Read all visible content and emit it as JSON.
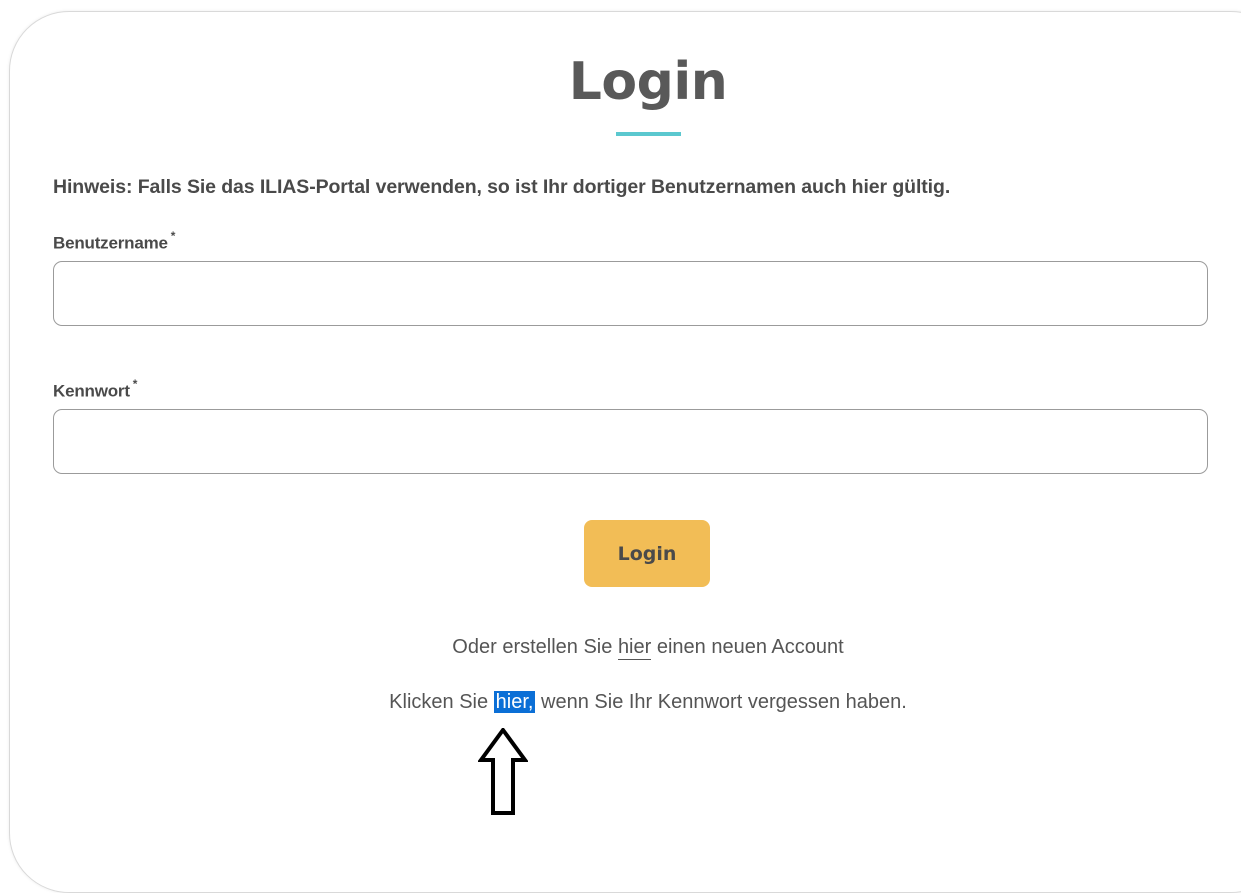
{
  "page": {
    "title": "Login",
    "hint": "Hinweis: Falls Sie das ILIAS-Portal verwenden, so ist Ihr dortiger Benutzernamen auch hier gültig."
  },
  "form": {
    "username_label": "Benutzername",
    "password_label": "Kennwort",
    "required_marker": "*",
    "username_value": "",
    "password_value": "",
    "submit_label": "Login"
  },
  "links": {
    "register_prefix": "Oder erstellen Sie ",
    "register_link": "hier",
    "register_suffix": " einen neuen Account",
    "forgot_prefix": "Klicken Sie ",
    "forgot_link": "hier,",
    "forgot_suffix": " wenn Sie Ihr Kennwort vergessen haben."
  },
  "icons": {
    "annotation_arrow": "up-arrow-icon"
  },
  "colors": {
    "accent_underline": "#5bc8cf",
    "button_bg": "#f2bd56",
    "selection_highlight": "#0b6fd6"
  }
}
